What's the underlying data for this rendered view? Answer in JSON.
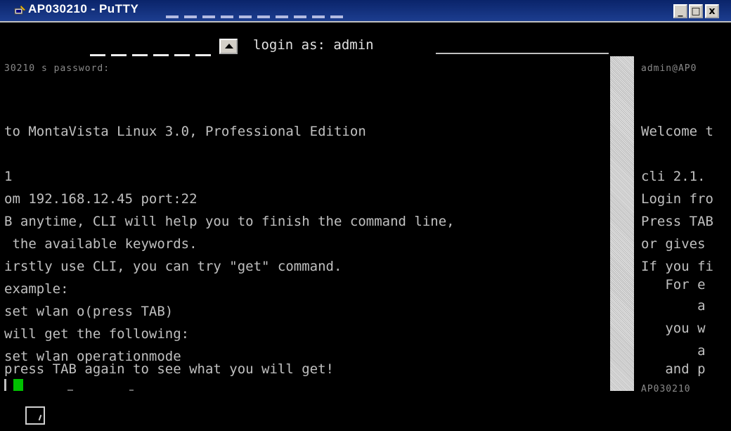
{
  "window": {
    "title": "AP030210 - PuTTY",
    "buttons": {
      "minimize": "_",
      "maximize": "□",
      "close": "x"
    }
  },
  "left_terminal": {
    "login_prompt": "login as: admin",
    "lines": [
      "30210 s password:",
      "to MontaVista Linux 3.0, Professional Edition",
      "1",
      "om 192.168.12.45 port:22",
      "B anytime, CLI will help you to finish the command line,",
      " the available keywords.",
      "irstly use CLI, you can try \"get\" command.",
      "example:",
      "set wlan o(press TAB)",
      "will get the following:",
      "set wlan operationmode",
      "press TAB again to see what you will get!"
    ]
  },
  "right_terminal": {
    "lines": [
      "admin@AP0",
      "Welcome t",
      "cli 2.1.",
      "Login fro",
      "Press TAB",
      "or gives",
      "If you fi",
      "   For e",
      "       a",
      "   you w",
      "       a",
      "   and p",
      "AP030210"
    ]
  },
  "icons": [
    "putty-icon",
    "scroll-up-icon",
    "resize-icon"
  ],
  "colors": {
    "titlebar": "#0a246a",
    "terminal_bg": "#000000",
    "terminal_text": "#c0c0c0",
    "cursor": "#00c000"
  }
}
